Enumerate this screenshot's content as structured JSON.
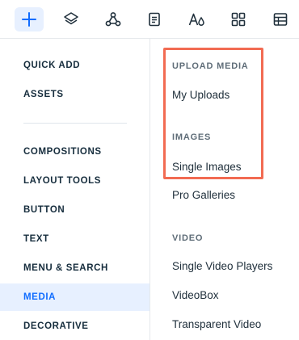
{
  "toolbar": {
    "buttons": [
      {
        "icon": "plus-icon",
        "active": true
      },
      {
        "icon": "layers-icon",
        "active": false
      },
      {
        "icon": "nodes-icon",
        "active": false
      },
      {
        "icon": "page-icon",
        "active": false
      },
      {
        "icon": "text-style-icon",
        "active": false
      },
      {
        "icon": "apps-grid-icon",
        "active": false
      },
      {
        "icon": "table-icon",
        "active": false
      }
    ],
    "accent_color": "#116dff"
  },
  "categories": [
    {
      "label": "QUICK ADD"
    },
    {
      "label": "ASSETS"
    },
    {
      "label": "COMPOSITIONS"
    },
    {
      "label": "LAYOUT TOOLS"
    },
    {
      "label": "BUTTON"
    },
    {
      "label": "TEXT"
    },
    {
      "label": "MENU & SEARCH"
    },
    {
      "label": "MEDIA",
      "selected": true
    },
    {
      "label": "DECORATIVE"
    }
  ],
  "submenu": {
    "upload_media_header": "UPLOAD MEDIA",
    "my_uploads": "My Uploads",
    "images_header": "IMAGES",
    "single_images": "Single Images",
    "pro_galleries": "Pro Galleries",
    "video_header": "VIDEO",
    "single_video_players": "Single Video Players",
    "videobox": "VideoBox",
    "transparent_video": "Transparent Video"
  },
  "colors": {
    "highlight_border": "#f26b52",
    "selected_bg": "#e7f0ff",
    "selected_text": "#116dff"
  }
}
